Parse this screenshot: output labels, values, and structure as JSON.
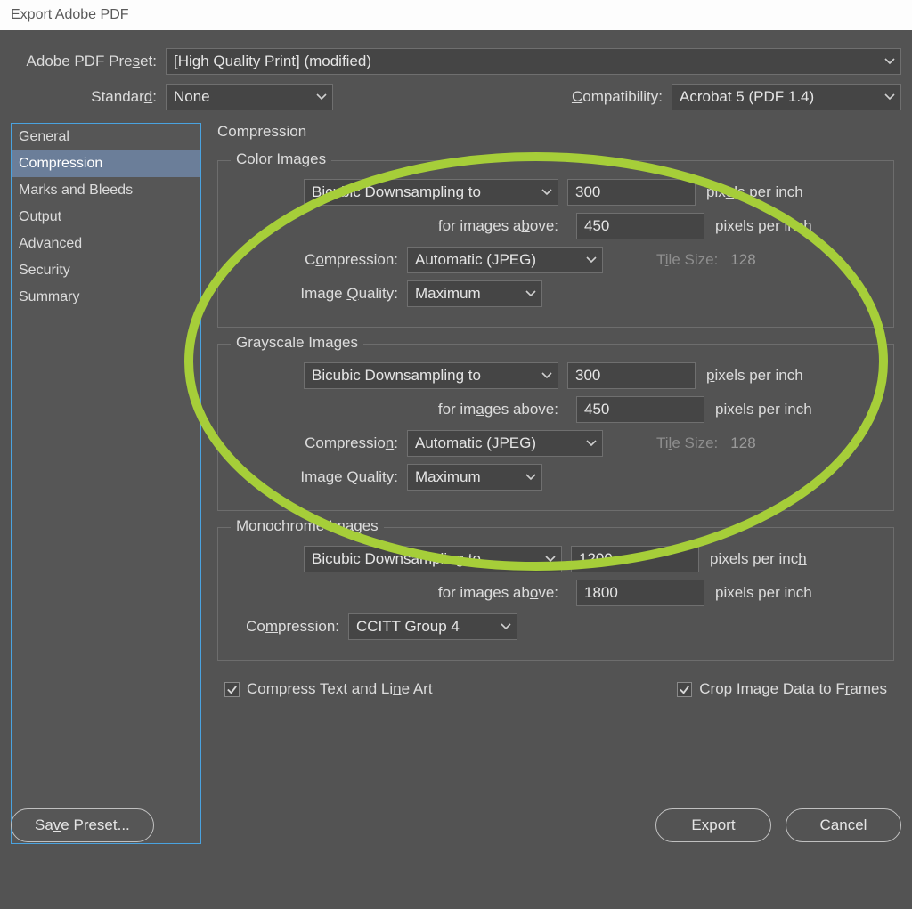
{
  "window_title": "Export Adobe PDF",
  "top": {
    "preset_label": "Adobe PDF Preset:",
    "preset_value": "[High Quality Print] (modified)",
    "standard_label": "Standard:",
    "standard_value": "None",
    "compat_label": "Compatibility:",
    "compat_value": "Acrobat 5 (PDF 1.4)"
  },
  "sidebar": {
    "items": [
      "General",
      "Compression",
      "Marks and Bleeds",
      "Output",
      "Advanced",
      "Security",
      "Summary"
    ]
  },
  "panel": {
    "title": "Compression",
    "color": {
      "title": "Color Images",
      "downsample": "Bicubic Downsampling to",
      "ppi_value": "300",
      "ppi_unit1": "pixels per inch",
      "above_label": "for images above:",
      "above_value": "450",
      "ppi_unit2": "pixels per inch",
      "compression_label": "Compression:",
      "compression_value": "Automatic (JPEG)",
      "tile_label": "Tile Size:",
      "tile_value": "128",
      "quality_label": "Image Quality:",
      "quality_value": "Maximum"
    },
    "gray": {
      "title": "Grayscale Images",
      "downsample": "Bicubic Downsampling to",
      "ppi_value": "300",
      "ppi_unit1": "pixels per inch",
      "above_label": "for images above:",
      "above_value": "450",
      "ppi_unit2": "pixels per inch",
      "compression_label": "Compression:",
      "compression_value": "Automatic (JPEG)",
      "tile_label": "Tile Size:",
      "tile_value": "128",
      "quality_label": "Image Quality:",
      "quality_value": "Maximum"
    },
    "mono": {
      "title": "Monochrome Images",
      "downsample": "Bicubic Downsampling to",
      "ppi_value": "1200",
      "ppi_unit1": "pixels per inch",
      "above_label": "for images above:",
      "above_value": "1800",
      "ppi_unit2": "pixels per inch",
      "compression_label": "Compression:",
      "compression_value": "CCITT Group 4"
    },
    "compress_text": "Compress Text and Line Art",
    "crop_image": "Crop Image Data to Frames"
  },
  "buttons": {
    "save_preset": "Save Preset...",
    "export": "Export",
    "cancel": "Cancel"
  }
}
